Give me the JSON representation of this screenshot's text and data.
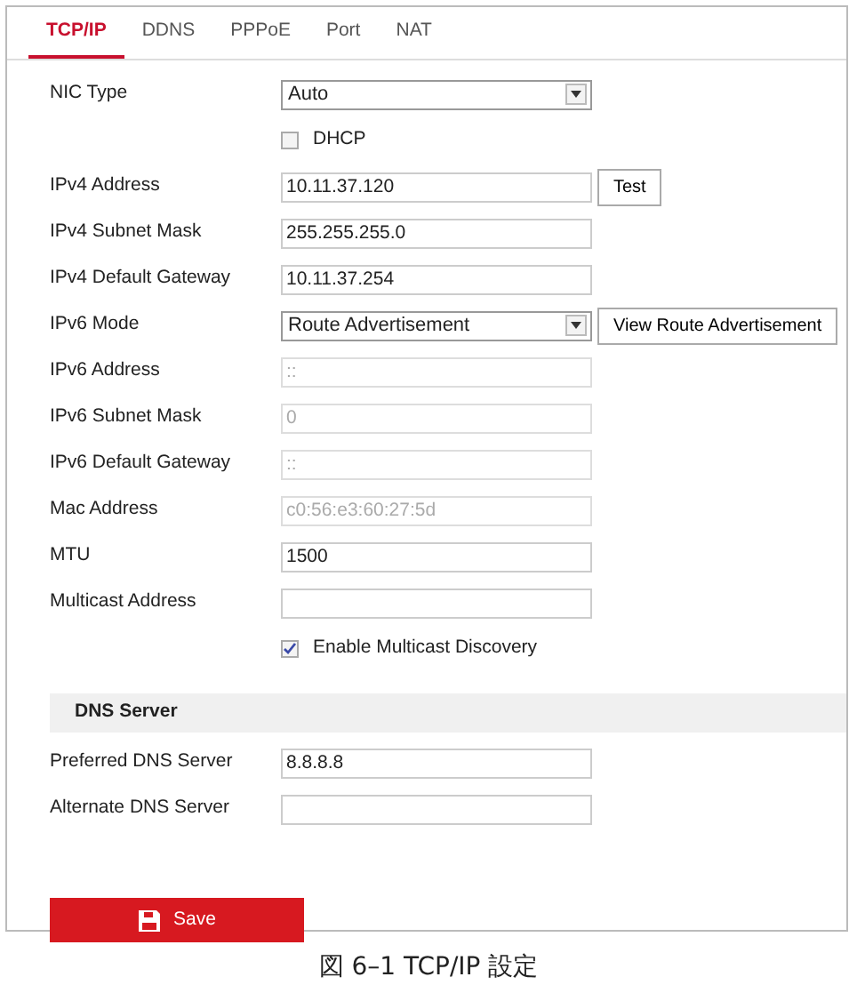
{
  "tabs": [
    {
      "label": "TCP/IP",
      "selected": true
    },
    {
      "label": "DDNS",
      "selected": false
    },
    {
      "label": "PPPoE",
      "selected": false
    },
    {
      "label": "Port",
      "selected": false
    },
    {
      "label": "NAT",
      "selected": false
    }
  ],
  "rows": [
    {
      "kind": "select",
      "label": "NIC Type",
      "value": "Auto"
    },
    {
      "kind": "checkbox",
      "label": "DHCP",
      "checked": false
    },
    {
      "kind": "text",
      "label": "IPv4 Address",
      "value": "10.11.37.120",
      "disabled": false,
      "button": "Test"
    },
    {
      "kind": "text",
      "label": "IPv4 Subnet Mask",
      "value": "255.255.255.0",
      "disabled": false
    },
    {
      "kind": "text",
      "label": "IPv4 Default Gateway",
      "value": "10.11.37.254",
      "disabled": false
    },
    {
      "kind": "select",
      "label": "IPv6 Mode",
      "value": "Route Advertisement",
      "button": "View Route Advertisement"
    },
    {
      "kind": "text",
      "label": "IPv6 Address",
      "value": "::",
      "disabled": true
    },
    {
      "kind": "text",
      "label": "IPv6 Subnet Mask",
      "value": "0",
      "disabled": true
    },
    {
      "kind": "text",
      "label": "IPv6 Default Gateway",
      "value": "::",
      "disabled": true
    },
    {
      "kind": "text",
      "label": "Mac Address",
      "value": "c0:56:e3:60:27:5d",
      "disabled": true
    },
    {
      "kind": "text",
      "label": "MTU",
      "value": "1500",
      "disabled": false
    },
    {
      "kind": "text",
      "label": "Multicast Address",
      "value": "",
      "disabled": false
    },
    {
      "kind": "checkbox",
      "label": "Enable Multicast Discovery",
      "checked": true
    }
  ],
  "dns_server": {
    "title": "DNS Server",
    "rows": [
      {
        "kind": "text",
        "label": "Preferred DNS Server",
        "value": "8.8.8.8",
        "disabled": false
      },
      {
        "kind": "text",
        "label": "Alternate DNS Server",
        "value": "",
        "disabled": false
      }
    ]
  },
  "save_button": "Save",
  "caption": "図 6–1 TCP/IP 設定"
}
